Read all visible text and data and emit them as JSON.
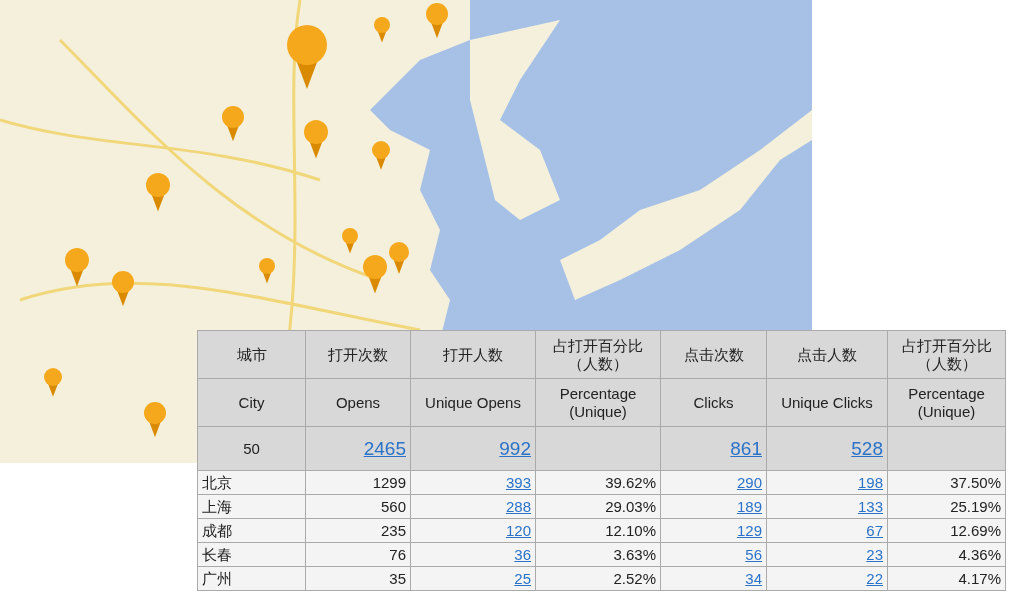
{
  "table": {
    "columns": [
      {
        "zh": "城市",
        "en": "City"
      },
      {
        "zh": "打开次数",
        "en": "Opens"
      },
      {
        "zh": "打开人数",
        "en": "Unique Opens"
      },
      {
        "zh": "占打开百分比（人数）",
        "en": "Percentage (Unique)"
      },
      {
        "zh": "点击次数",
        "en": "Clicks"
      },
      {
        "zh": "点击人数",
        "en": "Unique Clicks"
      },
      {
        "zh": "占打开百分比（人数）",
        "en": "Percentage (Unique)"
      }
    ],
    "totals": [
      {
        "text": "50",
        "kind": "plain"
      },
      {
        "text": "2465",
        "kind": "link"
      },
      {
        "text": "992",
        "kind": "link"
      },
      {
        "kind": "empty"
      },
      {
        "text": "861",
        "kind": "link"
      },
      {
        "text": "528",
        "kind": "link"
      },
      {
        "kind": "empty"
      }
    ],
    "rows": [
      [
        {
          "text": "北京",
          "kind": "city"
        },
        {
          "text": "1299",
          "kind": "plain"
        },
        {
          "text": "393",
          "kind": "link"
        },
        {
          "text": "39.62%",
          "kind": "plain"
        },
        {
          "text": "290",
          "kind": "link"
        },
        {
          "text": "198",
          "kind": "link"
        },
        {
          "text": "37.50%",
          "kind": "plain"
        }
      ],
      [
        {
          "text": "上海",
          "kind": "city"
        },
        {
          "text": "560",
          "kind": "plain"
        },
        {
          "text": "288",
          "kind": "link"
        },
        {
          "text": "29.03%",
          "kind": "plain"
        },
        {
          "text": "189",
          "kind": "link"
        },
        {
          "text": "133",
          "kind": "link"
        },
        {
          "text": "25.19%",
          "kind": "plain"
        }
      ],
      [
        {
          "text": "成都",
          "kind": "city"
        },
        {
          "text": "235",
          "kind": "plain"
        },
        {
          "text": "120",
          "kind": "link"
        },
        {
          "text": "12.10%",
          "kind": "plain"
        },
        {
          "text": "129",
          "kind": "link"
        },
        {
          "text": "67",
          "kind": "link"
        },
        {
          "text": "12.69%",
          "kind": "plain"
        }
      ],
      [
        {
          "text": "长春",
          "kind": "city"
        },
        {
          "text": "76",
          "kind": "plain"
        },
        {
          "text": "36",
          "kind": "link"
        },
        {
          "text": "3.63%",
          "kind": "plain"
        },
        {
          "text": "56",
          "kind": "link"
        },
        {
          "text": "23",
          "kind": "link"
        },
        {
          "text": "4.36%",
          "kind": "plain"
        }
      ],
      [
        {
          "text": "广州",
          "kind": "city"
        },
        {
          "text": "35",
          "kind": "plain"
        },
        {
          "text": "25",
          "kind": "link"
        },
        {
          "text": "2.52%",
          "kind": "plain"
        },
        {
          "text": "34",
          "kind": "link"
        },
        {
          "text": "22",
          "kind": "link"
        },
        {
          "text": "4.17%",
          "kind": "plain"
        }
      ]
    ]
  }
}
